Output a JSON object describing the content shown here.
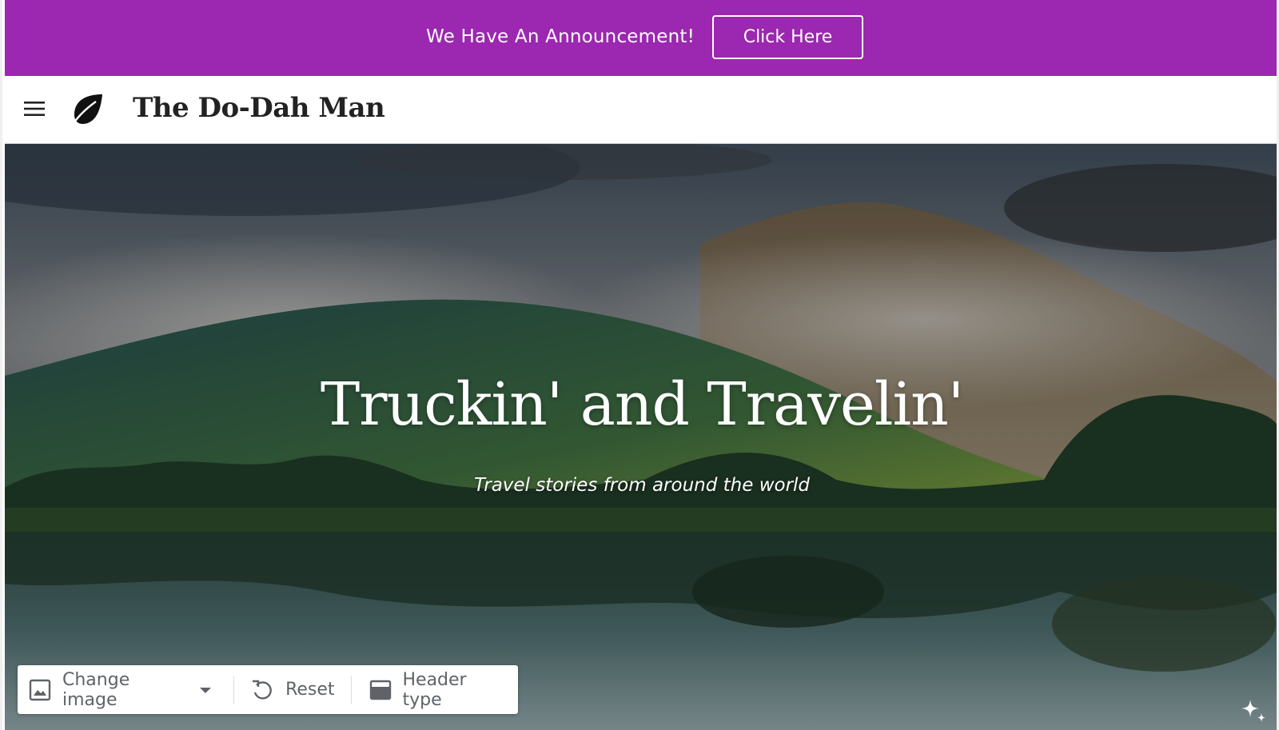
{
  "announcement": {
    "text": "We Have An Announcement!",
    "button_label": "Click Here",
    "background_color": "#9c27b0"
  },
  "header": {
    "menu_icon": "hamburger-menu-icon",
    "logo_icon": "leaf-icon",
    "site_title": "The Do-Dah Man"
  },
  "hero": {
    "title": "Truckin' and Travelin'",
    "subtitle": "Travel stories from around the world",
    "image": "misty-mountain-lake-landscape"
  },
  "toolbar": {
    "change_image_label": "Change image",
    "change_image_icon": "image-icon",
    "dropdown_icon": "caret-down-icon",
    "reset_label": "Reset",
    "reset_icon": "undo-icon",
    "header_type_label": "Header type",
    "header_type_icon": "header-layout-icon"
  },
  "assistant_icon": "sparkle-icon"
}
